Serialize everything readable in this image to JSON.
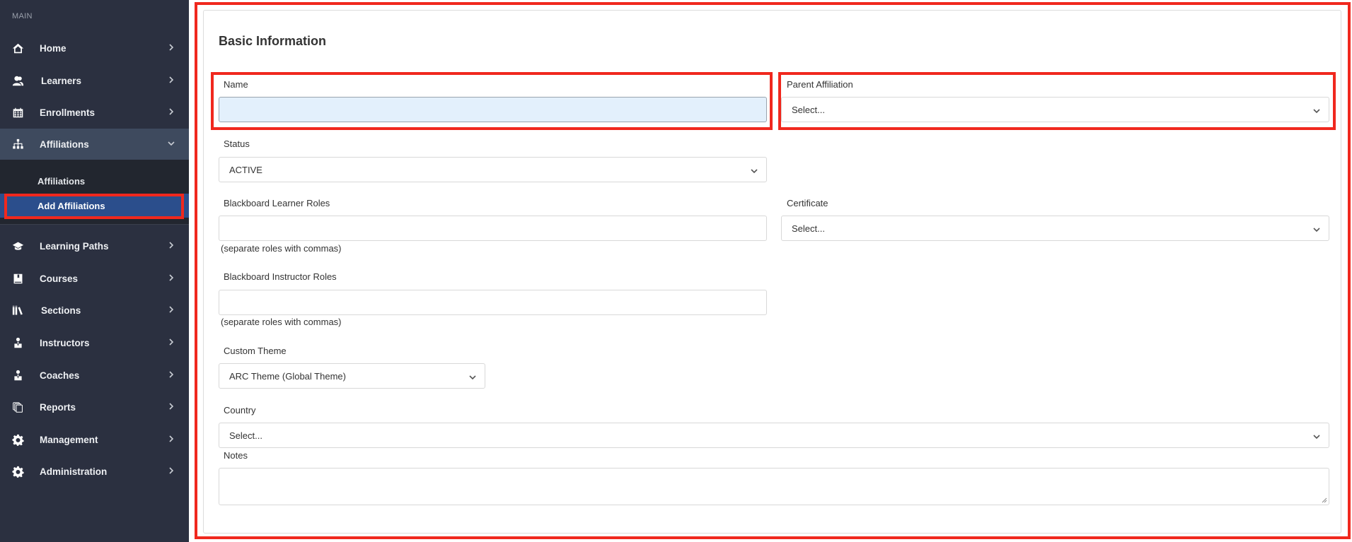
{
  "sidebar": {
    "heading": "MAIN",
    "items": [
      {
        "label": "Home",
        "icon": "home-icon"
      },
      {
        "label": "Learners",
        "icon": "learners-icon"
      },
      {
        "label": "Enrollments",
        "icon": "calendar-icon"
      },
      {
        "label": "Affiliations",
        "icon": "sitemap-icon",
        "expanded": true
      },
      {
        "label": "Learning Paths",
        "icon": "graduation-cap-icon"
      },
      {
        "label": "Courses",
        "icon": "book-icon"
      },
      {
        "label": "Sections",
        "icon": "library-icon"
      },
      {
        "label": "Instructors",
        "icon": "instructor-icon"
      },
      {
        "label": "Coaches",
        "icon": "coach-icon"
      },
      {
        "label": "Reports",
        "icon": "copy-icon"
      },
      {
        "label": "Management",
        "icon": "gear-icon"
      },
      {
        "label": "Administration",
        "icon": "gear-icon"
      }
    ],
    "submenu": [
      {
        "label": "Affiliations"
      },
      {
        "label": "Add Affiliations",
        "active": true
      }
    ]
  },
  "form": {
    "title": "Basic Information",
    "name": {
      "label": "Name",
      "value": ""
    },
    "parent_affiliation": {
      "label": "Parent Affiliation",
      "value": "Select..."
    },
    "status": {
      "label": "Status",
      "value": "ACTIVE"
    },
    "learner_roles": {
      "label": "Blackboard Learner Roles",
      "value": "",
      "help": "(separate roles with commas)"
    },
    "certificate": {
      "label": "Certificate",
      "value": "Select..."
    },
    "instructor_roles": {
      "label": "Blackboard Instructor Roles",
      "value": "",
      "help": "(separate roles with commas)"
    },
    "custom_theme": {
      "label": "Custom Theme",
      "value": "ARC Theme (Global Theme)"
    },
    "country": {
      "label": "Country",
      "value": "Select..."
    },
    "notes": {
      "label": "Notes",
      "value": ""
    }
  },
  "colors": {
    "sidebar_bg": "#2b3040",
    "sidebar_open": "#3e4a5e",
    "submenu_bg": "#22262f",
    "active_item": "#2b4e8c",
    "highlight": "#f0281e",
    "focused_input": "#e3f0fc"
  }
}
